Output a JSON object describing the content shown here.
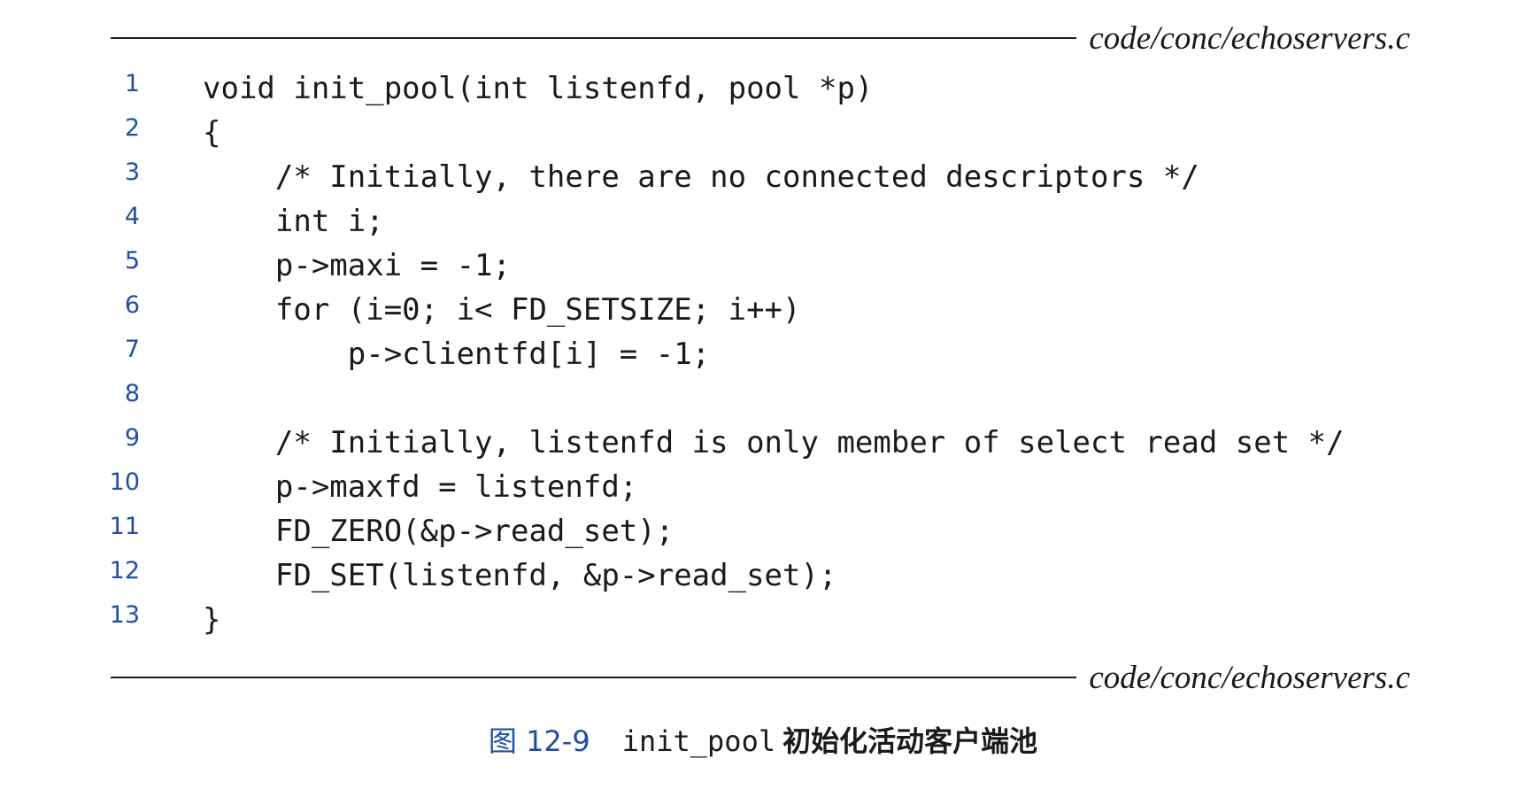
{
  "header": {
    "filename": "code/conc/echoservers.c"
  },
  "code": {
    "lines": [
      {
        "num": "1",
        "text": "void init_pool(int listenfd, pool *p)"
      },
      {
        "num": "2",
        "text": "{"
      },
      {
        "num": "3",
        "text": "    /* Initially, there are no connected descriptors */"
      },
      {
        "num": "4",
        "text": "    int i;"
      },
      {
        "num": "5",
        "text": "    p->maxi = -1;"
      },
      {
        "num": "6",
        "text": "    for (i=0; i< FD_SETSIZE; i++)"
      },
      {
        "num": "7",
        "text": "        p->clientfd[i] = -1;"
      },
      {
        "num": "8",
        "text": ""
      },
      {
        "num": "9",
        "text": "    /* Initially, listenfd is only member of select read set */"
      },
      {
        "num": "10",
        "text": "    p->maxfd = listenfd;"
      },
      {
        "num": "11",
        "text": "    FD_ZERO(&p->read_set);"
      },
      {
        "num": "12",
        "text": "    FD_SET(listenfd, &p->read_set);"
      },
      {
        "num": "13",
        "text": "}"
      }
    ]
  },
  "footer": {
    "filename": "code/conc/echoservers.c"
  },
  "caption": {
    "figure_number": "图 12-9",
    "function_name": "init_pool",
    "description": "初始化活动客户端池"
  },
  "colors": {
    "line_number": "#1f4fa0",
    "text": "#1a1a1a",
    "background": "#ffffff"
  }
}
